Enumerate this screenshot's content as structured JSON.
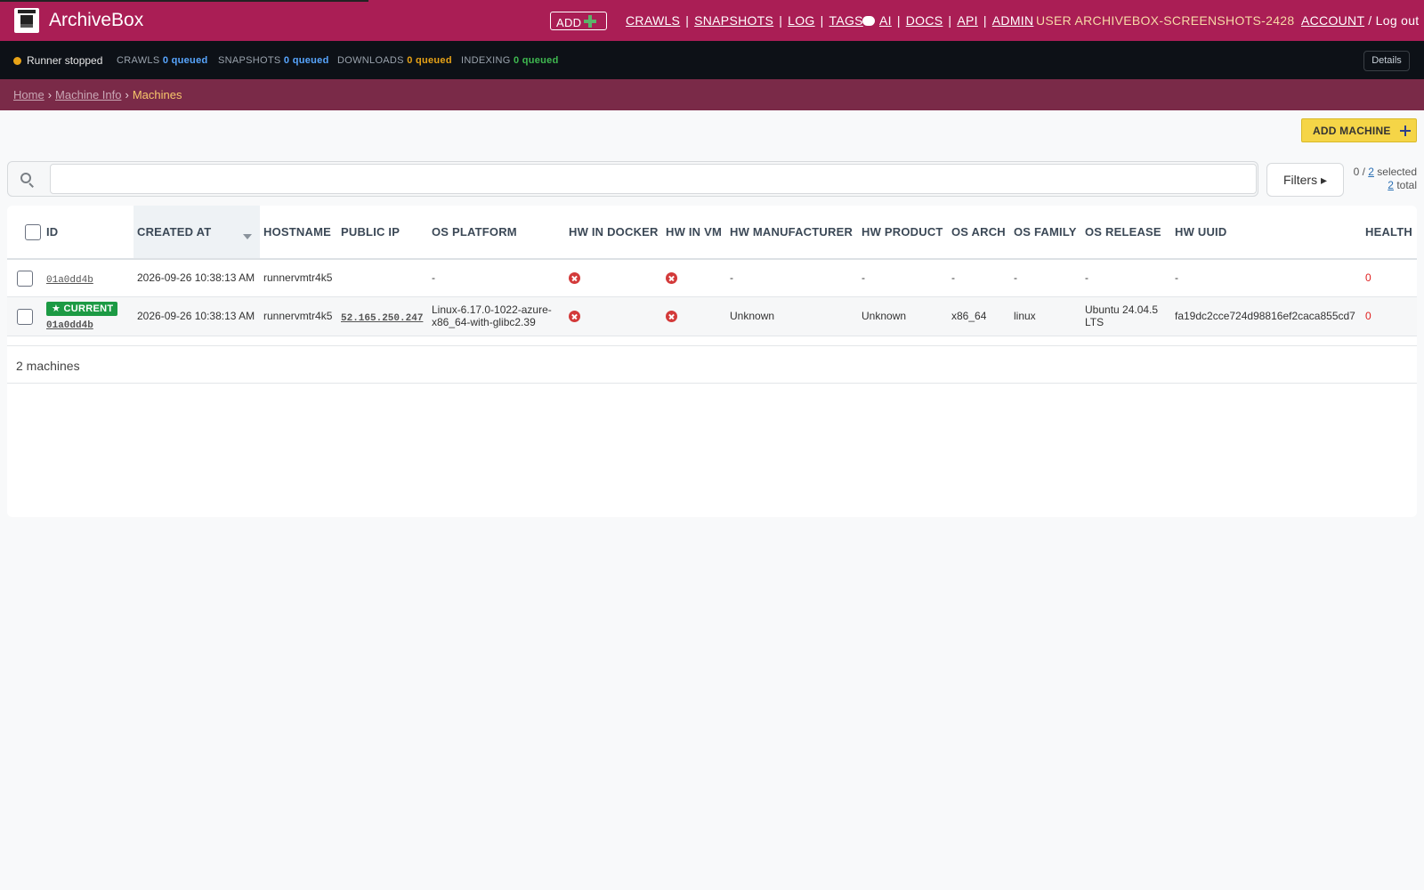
{
  "header": {
    "brand": "ArchiveBox",
    "add_label": "ADD",
    "nav_main": [
      "CRAWLS",
      "SNAPSHOTS",
      "LOG",
      "TAGS"
    ],
    "nav_help": [
      "AI",
      "DOCS",
      "API",
      "ADMIN"
    ],
    "user_label": "USER ARCHIVEBOX-SCREENSHOTS-2428",
    "account_label": "ACCOUNT",
    "logout_label": "Log out"
  },
  "status": {
    "runner": "Runner stopped",
    "crawls_label": "CRAWLS",
    "crawls_value": "0 queued",
    "snapshots_label": "SNAPSHOTS",
    "snapshots_value": "0 queued",
    "downloads_label": "DOWNLOADS",
    "downloads_value": "0 queued",
    "indexing_label": "INDEXING",
    "indexing_value": "0 queued",
    "details_label": "Details",
    "colors": {
      "runner_dot": "#e8a317",
      "crawls": "#58a6ff",
      "snapshots": "#58a6ff",
      "downloads": "#e8a317",
      "indexing": "#3fb950"
    }
  },
  "breadcrumb": {
    "home": "Home",
    "machine_info": "Machine Info",
    "current": "Machines"
  },
  "toolbar": {
    "add_machine_label": "ADD MACHINE",
    "search_placeholder": "",
    "filters_label": "Filters ▸",
    "selected_count": "0",
    "selected_total": "2",
    "selected_suffix": "selected",
    "total_count": "2",
    "total_suffix": "total"
  },
  "table": {
    "headers": [
      "ID",
      "CREATED AT",
      "HOSTNAME",
      "PUBLIC IP",
      "OS PLATFORM",
      "HW IN DOCKER",
      "HW IN VM",
      "HW MANUFACTURER",
      "HW PRODUCT",
      "OS ARCH",
      "OS FAMILY",
      "OS RELEASE",
      "HW UUID",
      "HEALTH"
    ],
    "rows": [
      {
        "id": "01a0dd4b",
        "created_at": "2026-09-26 10:38:13 AM",
        "hostname": "runnervmtr4k5",
        "public_ip": "",
        "os_platform": "-",
        "hw_in_docker": "false-icon",
        "hw_in_vm": "false-icon",
        "hw_manufacturer": "-",
        "hw_product": "-",
        "os_arch": "-",
        "os_family": "-",
        "os_release": "-",
        "hw_uuid": "-",
        "health": "0"
      },
      {
        "badge": "★ CURRENT",
        "id": "01a0dd4b",
        "created_at": "2026-09-26 10:38:13 AM",
        "hostname": "runnervmtr4k5",
        "public_ip": "52.165.250.247",
        "os_platform": "Linux-6.17.0-1022-azure-x86_64-with-glibc2.39",
        "hw_in_docker": "false-icon",
        "hw_in_vm": "false-icon",
        "hw_manufacturer": "Unknown",
        "hw_product": "Unknown",
        "os_arch": "x86_64",
        "os_family": "linux",
        "os_release": "Ubuntu 24.04.5 LTS",
        "hw_uuid": "fa19dc2cce724d98816ef2caca855cd7",
        "health": "0"
      }
    ],
    "footer": "2 machines"
  }
}
